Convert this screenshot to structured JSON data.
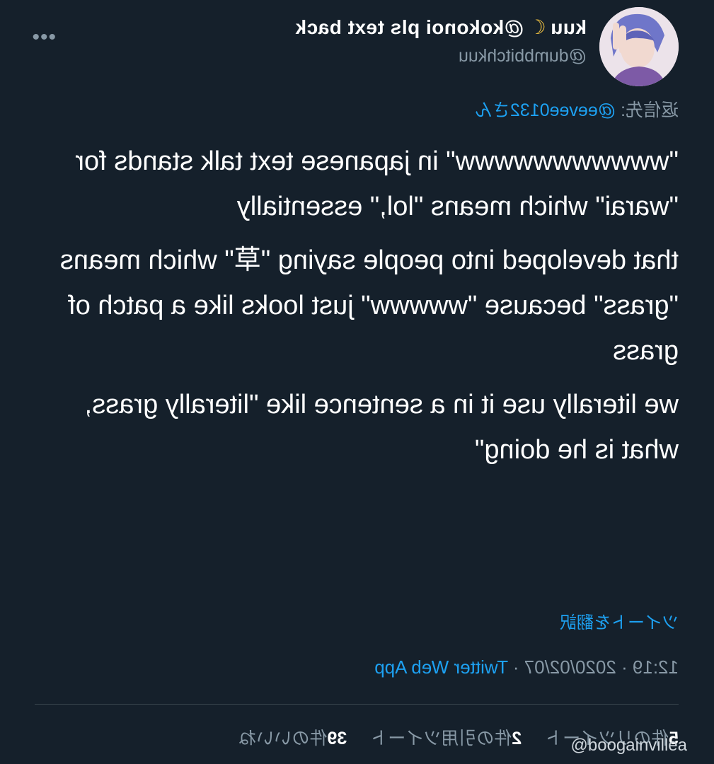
{
  "tweet": {
    "display_name": "kuu 🌙@kokonoi pls text back",
    "display_name_before_emoji": "kuu",
    "display_name_after_emoji": "@kokonoi pls text back",
    "handle": "@dumbbitchkuu",
    "reply_prefix": "返信先: ",
    "reply_mention": "@eevee0132さん",
    "paragraphs": [
      "\"wwwwwwwwwww\" in japanese text talk stands for \"warai\" which means \"lol,\" essentially",
      "that developed into people saying \"草\" which means \"grass\" because \"wwwww\" just looks like a patch of grass",
      "we literally use it in a sentence like \"literally grass, what is he doing\""
    ],
    "translate_label": "ツイートを翻訳",
    "timestamp": "12:19 · 2020/02/07 · ",
    "source": "Twitter Web App",
    "stats": {
      "retweets_count": "5",
      "retweets_label": "件のリツイート",
      "quotes_count": "2",
      "quotes_label": "件の引用ツイート",
      "likes_count": "39",
      "likes_label": "件のいいね"
    }
  },
  "watermark": "@boogainvillea",
  "colors": {
    "background": "#15202b",
    "text": "#ffffff",
    "secondary": "#8899a6",
    "link": "#1da1f2",
    "divider": "#38444d"
  },
  "icons": {
    "more": "more-horizontal-icon",
    "moon": "crescent-moon-icon"
  }
}
